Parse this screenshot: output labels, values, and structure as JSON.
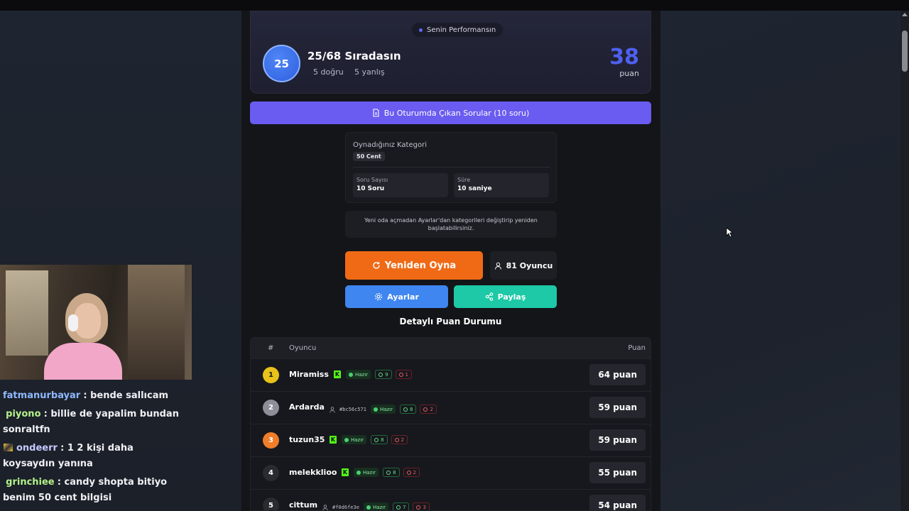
{
  "performance": {
    "pill_label": "Senin Performansın",
    "rank": "25",
    "rank_title": "25/68 Sıradasın",
    "correct": "5 doğru",
    "wrong": "5 yanlış",
    "score": "38",
    "score_unit": "puan"
  },
  "questions_button": "Bu Oturumda Çıkan Sorular (10 soru)",
  "category": {
    "label": "Oynadığınız Kategori",
    "tag": "50 Cent",
    "question_count_label": "Soru Sayısı",
    "question_count_value": "10 Soru",
    "duration_label": "Süre",
    "duration_value": "10 saniye"
  },
  "info_text": "Yeni oda açmadan Ayarlar'dan kategorileri değiştirip yeniden başlatabilirsiniz.",
  "buttons": {
    "replay": "Yeniden Oyna",
    "players": "81 Oyuncu",
    "settings": "Ayarlar",
    "share": "Paylaş"
  },
  "detail_title": "Detaylı Puan Durumu",
  "table": {
    "headers": {
      "hash": "#",
      "player": "Oyuncu",
      "score": "Puan"
    },
    "rows": [
      {
        "rank": "1",
        "name": "Miramiss",
        "kick": true,
        "uid": "",
        "ready": "Hazır",
        "correct": "9",
        "wrong": "1",
        "score": "64 puan",
        "badge_color": "#e8c21a",
        "badge_text": "#1a1a1a"
      },
      {
        "rank": "2",
        "name": "Ardarda",
        "kick": false,
        "uid": "#bc56c571",
        "ready": "Hazır",
        "correct": "8",
        "wrong": "2",
        "score": "59 puan",
        "badge_color": "#8d8f98",
        "badge_text": "#ffffff"
      },
      {
        "rank": "3",
        "name": "tuzun35",
        "kick": true,
        "uid": "",
        "ready": "Hazır",
        "correct": "8",
        "wrong": "2",
        "score": "59 puan",
        "badge_color": "#f07d2a",
        "badge_text": "#ffffff"
      },
      {
        "rank": "4",
        "name": "melekklioo",
        "kick": true,
        "uid": "",
        "ready": "Hazır",
        "correct": "8",
        "wrong": "2",
        "score": "55 puan",
        "badge_color": "#2a2b31",
        "badge_text": "#ffffff"
      },
      {
        "rank": "5",
        "name": "cittum",
        "kick": false,
        "uid": "#f0d6fe3e",
        "ready": "Hazır",
        "correct": "7",
        "wrong": "3",
        "score": "54 puan",
        "badge_color": "#2a2b31",
        "badge_text": "#ffffff"
      }
    ]
  },
  "chat": [
    {
      "user": "fatmanurbayar",
      "message": ": bende sallıcam",
      "badge": false
    },
    {
      "user": "piyono",
      "message": ": billie de yapalim bundan sonraltfn",
      "badge": false
    },
    {
      "user": "ondeerr",
      "message": ": 1 2 kişi daha koysaydın yanına",
      "badge": true
    },
    {
      "user": "grinchiee",
      "message": ": candy shopta bitiyo benim 50 cent bilgisi",
      "badge": false
    }
  ],
  "colors": {
    "accent_purple": "#6a5cf0",
    "replay_orange": "#f06a16",
    "settings_blue": "#3f86f0",
    "share_teal": "#1dc9a6",
    "score_blue": "#4f60ef"
  }
}
